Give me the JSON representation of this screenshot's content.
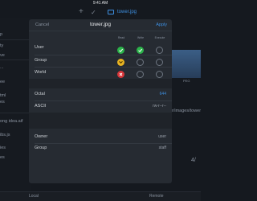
{
  "status_bar": {
    "time": "9:41 AM"
  },
  "top_bar": {
    "plus_glyph": "+",
    "check_glyph": "✓",
    "file_name": "tower.jpg"
  },
  "sidebar": {
    "items": [
      {
        "label": "p"
      },
      {
        "label": "ty"
      },
      {
        "label": "ve"
      },
      {
        "label": "..."
      },
      {
        "label": "ee"
      },
      {
        "label": "tml"
      },
      {
        "label": "es"
      },
      {
        "label": "ong idea.aif"
      },
      {
        "label": "ibs.js"
      },
      {
        "label": "ies"
      },
      {
        "label": "es"
      }
    ]
  },
  "background": {
    "preview_caption": "PEG",
    "path_text": "r/images/tower",
    "page_text": "4/"
  },
  "bottom_bar": {
    "left": "Local",
    "right": "Remote"
  },
  "dialog": {
    "cancel_label": "Cancel",
    "title": "tower.jpg",
    "apply_label": "Apply",
    "columns": [
      "Read",
      "Write",
      "Execute"
    ],
    "rows": [
      {
        "label": "User",
        "read": true,
        "write": true,
        "execute": false,
        "accent": "#2bb34a"
      },
      {
        "label": "Group",
        "read": true,
        "write": false,
        "execute": false,
        "accent": "#e8b321"
      },
      {
        "label": "World",
        "read": true,
        "write": false,
        "execute": false,
        "accent": "#d8363a"
      }
    ],
    "octal": {
      "label": "Octal",
      "value": "644",
      "value_color": "#3d8fe0"
    },
    "ascii": {
      "label": "ASCII",
      "value": "rw-r--r--"
    },
    "owner": {
      "label": "Owner",
      "value": "user"
    },
    "group": {
      "label": "Group",
      "value": "staff"
    }
  }
}
